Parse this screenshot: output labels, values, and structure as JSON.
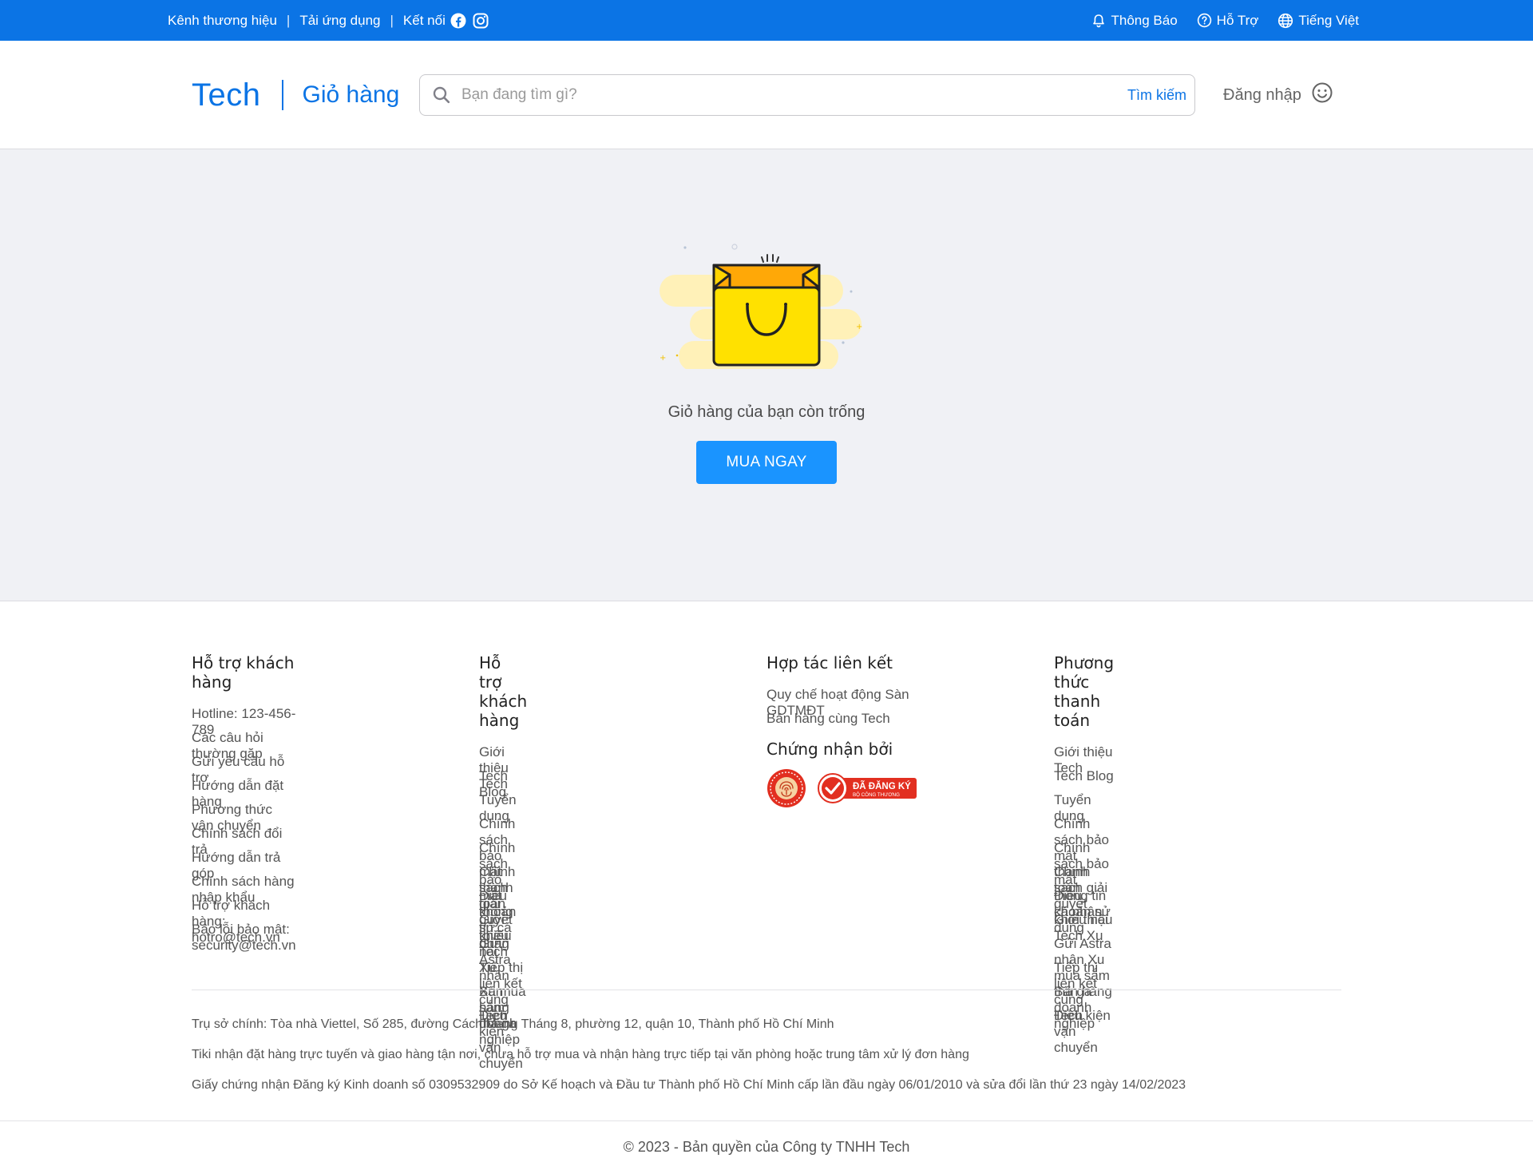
{
  "topbar": {
    "brand_channel": "Kênh thương hiệu",
    "download_app": "Tải ứng dụng",
    "connect": "Kết nối",
    "notifications": "Thông Báo",
    "support": "Hỗ Trợ",
    "language": "Tiếng Việt",
    "bg_color": "#0b74e5"
  },
  "header": {
    "logo": "Tech",
    "page_title": "Giỏ hàng",
    "search_placeholder": "Bạn đang tìm gì?",
    "search_button": "Tìm kiếm",
    "login": "Đăng nhập"
  },
  "cart": {
    "empty_message": "Giỏ hàng của bạn còn trống",
    "buy_button": "MUA NGAY",
    "button_color": "#1a94ff"
  },
  "footer": {
    "col1": {
      "title": "Hỗ trợ khách hàng",
      "items": [
        "Hotline: 123-456-789",
        "Các câu hỏi thường gặp",
        "Gửi yêu cầu hỗ trợ",
        "Hướng dẫn đặt hàng",
        "Phương thức vận chuyển",
        "Chính sách đổi trả",
        "Hướng dẫn trả góp",
        "Chính sách hàng nhập khẩu",
        "Hỗ trợ khách hàng: hotro@tech.vn",
        "Báo lỗi bảo mật: security@tech.vn"
      ]
    },
    "col2": {
      "title": "Hỗ trợ khách hàng",
      "items": [
        "Giới thiệu Tech",
        "Tech Blog",
        "Tuyển dụng",
        "Chính sách bảo mật thanh toán",
        "Chính sách bảo mật thông tin cá nhân",
        "Chính sách giải quyết khiếu nại",
        "Điều khoản sử dụng",
        "Giới thiệu Tech Xu",
        "Gửi Astra nhận Xu mua sắm thả ga",
        "Tiếp thị liên kết cùng Tech",
        "Bán hàng doanh nghiệp",
        "Điều kiện vận chuyển"
      ]
    },
    "col3": {
      "title": "Hợp tác liên kết",
      "items": [
        "Quy chế hoạt động Sàn GDTMĐT",
        "Bán hàng cùng Tech"
      ],
      "cert_title": "Chứng nhận bởi",
      "badge_registered": "ĐÃ ĐĂNG KÝ",
      "badge_ministry": "BỘ CÔNG THƯƠNG"
    },
    "col4": {
      "title": "Phương thức thanh toán",
      "items": [
        "Giới thiệu Tech",
        "Tech Blog",
        "Tuyển dụng",
        "Chính sách bảo mật thanh toán",
        "Chính sách bảo mật thông tin cá nhân",
        "Chính sách giải quyết khiếu nại",
        "Điều khoản sử dụng",
        "Giới thiệu Tech Xu",
        "Gửi Astra nhận Xu mua sắm thả ga",
        "Tiếp thị liên kết cùng Tech",
        "Bán hàng doanh nghiệp",
        "Điều kiện vận chuyển"
      ]
    },
    "info": [
      "Trụ sở chính: Tòa nhà Viettel, Số 285, đường Cách Mạng Tháng 8, phường 12, quận 10, Thành phố Hồ Chí Minh",
      "Tiki nhận đặt hàng trực tuyến và giao hàng tận nơi, chưa hỗ trợ mua và nhận hàng trực tiếp tại văn phòng hoặc trung tâm xử lý đơn hàng",
      "Giấy chứng nhận Đăng ký Kinh doanh số 0309532909 do Sở Kế hoạch và Đầu tư Thành phố Hồ Chí Minh cấp lần đầu ngày 06/01/2010 và sửa đổi lần thứ 23 ngày 14/02/2023"
    ],
    "copyright": "© 2023 - Bản quyền của Công ty TNHH Tech"
  }
}
